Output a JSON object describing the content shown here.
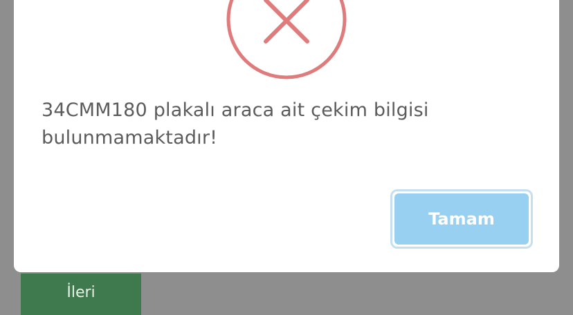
{
  "background": {
    "next_button_label": "İleri"
  },
  "dialog": {
    "icon": "error-x-icon",
    "message": "34CMM180 plakalı araca ait çekim bilgisi bulunmamaktadır!",
    "confirm_label": "Tamam"
  },
  "colors": {
    "overlay": "#8e8e8e",
    "next_button": "#3e7a4d",
    "error_icon": "#e07b7b",
    "confirm_button": "#98d0f1",
    "message_text": "#5b5b5b"
  }
}
